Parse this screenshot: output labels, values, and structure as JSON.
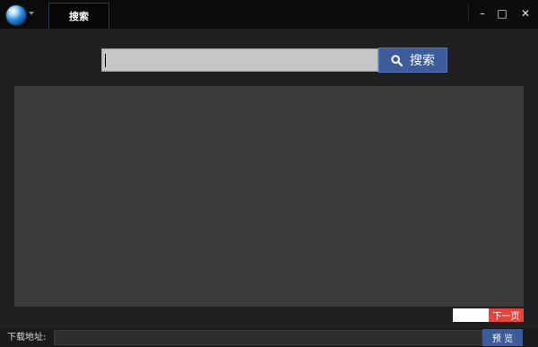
{
  "titlebar": {
    "logo_icon": "globe-icon",
    "active_tab": "搜索",
    "minimize_glyph": "–",
    "maximize_glyph": "□",
    "close_glyph": "✕"
  },
  "search": {
    "input_value": "",
    "button_label": "搜索",
    "button_icon": "search-icon"
  },
  "pagination": {
    "page_value": "",
    "next_label": "下一页"
  },
  "bottom": {
    "download_label": "下载地址:",
    "download_value": "",
    "preview_label": "预 览"
  },
  "colors": {
    "accent_blue": "#3c5c9a",
    "next_red": "#e3453c",
    "results_bg": "#3c3c3c"
  }
}
